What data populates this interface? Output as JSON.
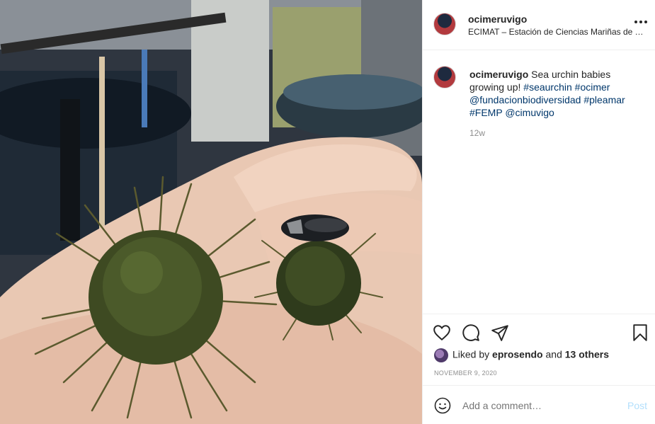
{
  "post": {
    "username": "ocimeruvigo",
    "location": "ECIMAT – Estación de Ciencias Mariñas de Tor…",
    "caption_text": "Sea urchin babies growing up!",
    "hashtags": [
      "#seaurchin",
      "#ocimer",
      "@fundacionbiodiversidad",
      "#pleamar",
      "#FEMP",
      "@cimuvigo"
    ],
    "time_ago": "12w",
    "liked_by_prefix": "Liked by",
    "liked_by_user": "eprosendo",
    "liked_by_and": "and",
    "liked_by_others": "13 others",
    "date": "NOVEMBER 9, 2020"
  },
  "comment": {
    "placeholder": "Add a comment…",
    "post_label": "Post"
  },
  "icons": {
    "more": "more-options-icon",
    "like": "heart-icon",
    "comment": "comment-icon",
    "share": "paper-plane-icon",
    "save": "bookmark-icon",
    "emoji": "emoji-icon"
  },
  "colors": {
    "link": "#00376b",
    "muted": "#8e8e8e",
    "post_disabled": "#b2dffc",
    "border": "#efefef"
  }
}
